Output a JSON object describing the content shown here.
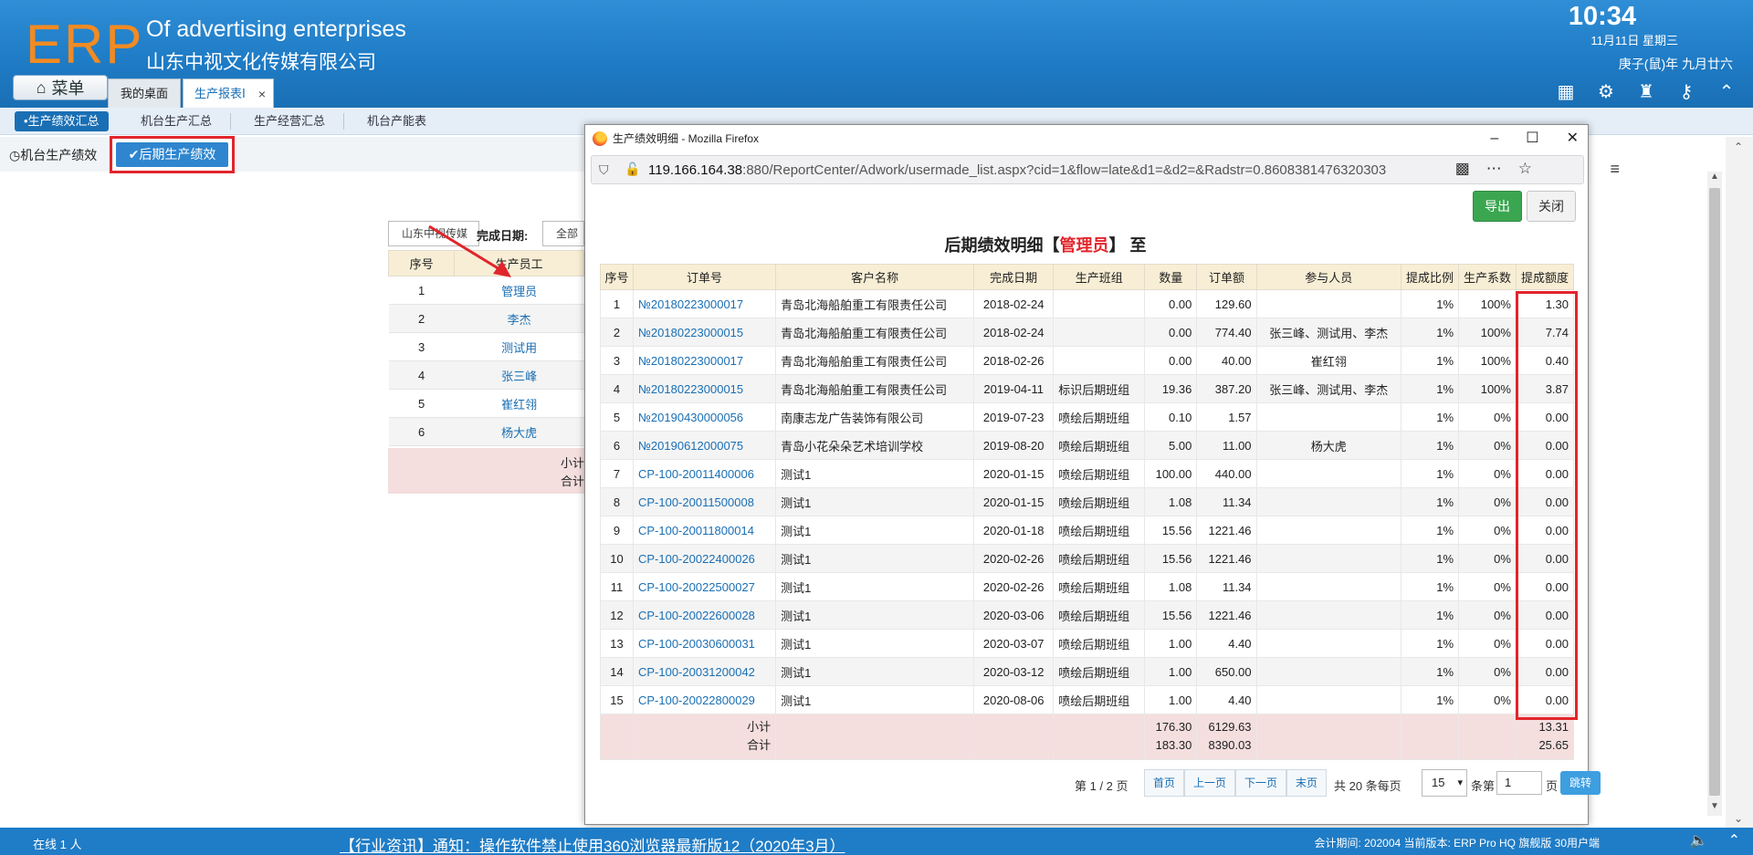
{
  "header": {
    "logo": "ERP",
    "brand_en": "Of advertising enterprises",
    "brand_cn": "山东中视文化传媒有限公司",
    "time": "10:34",
    "date": "11月11日 星期三",
    "lunar": "庚子(鼠)年 九月廿六",
    "menu_label": "菜单",
    "tabs": [
      {
        "label": "我的桌面"
      },
      {
        "label": "生产报表Ⅰ"
      }
    ],
    "tab_close": "×"
  },
  "subnav": {
    "items": [
      "•生产绩效汇总",
      "机台生产汇总",
      "生产经营汇总",
      "机台产能表"
    ]
  },
  "modes": {
    "a": "机台生产绩效",
    "b": "后期生产绩效"
  },
  "bg_list": {
    "company_select": "山东中视传媒",
    "date_label": "完成日期:",
    "date_select": "全部",
    "columns": [
      "序号",
      "生产员工"
    ],
    "rows": [
      {
        "no": "1",
        "name": "管理员"
      },
      {
        "no": "2",
        "name": "李杰"
      },
      {
        "no": "3",
        "name": "测试用"
      },
      {
        "no": "4",
        "name": "张三峰"
      },
      {
        "no": "5",
        "name": "崔红翎"
      },
      {
        "no": "6",
        "name": "杨大虎"
      }
    ],
    "subtotal": "小计",
    "total": "合计"
  },
  "popup": {
    "title": "生产绩效明细 - Mozilla Firefox",
    "url_host": "119.166.164.38",
    "url_rest": ":880/ReportCenter/Adwork/usermade_list.aspx?cid=1&flow=late&d1=&d2=&Radstr=0.8608381476320303",
    "export_label": "导出",
    "close_label": "关闭",
    "report_title_pre": "后期绩效明细【",
    "report_title_user": "管理员",
    "report_title_post": "】 至",
    "columns": [
      "序号",
      "订单号",
      "客户名称",
      "完成日期",
      "生产班组",
      "数量",
      "订单额",
      "参与人员",
      "提成比例",
      "生产系数",
      "提成额度"
    ],
    "rows": [
      [
        "1",
        "№20180223000017",
        "青岛北海船舶重工有限责任公司",
        "2018-02-24",
        "",
        "0.00",
        "129.60",
        "",
        "1%",
        "100%",
        "1.30"
      ],
      [
        "2",
        "№20180223000015",
        "青岛北海船舶重工有限责任公司",
        "2018-02-24",
        "",
        "0.00",
        "774.40",
        "张三峰、测试用、李杰",
        "1%",
        "100%",
        "7.74"
      ],
      [
        "3",
        "№20180223000017",
        "青岛北海船舶重工有限责任公司",
        "2018-02-26",
        "",
        "0.00",
        "40.00",
        "崔红翎",
        "1%",
        "100%",
        "0.40"
      ],
      [
        "4",
        "№20180223000015",
        "青岛北海船舶重工有限责任公司",
        "2019-04-11",
        "标识后期班组",
        "19.36",
        "387.20",
        "张三峰、测试用、李杰",
        "1%",
        "100%",
        "3.87"
      ],
      [
        "5",
        "№20190430000056",
        "南康志龙广告装饰有限公司",
        "2019-07-23",
        "喷绘后期班组",
        "0.10",
        "1.57",
        "",
        "1%",
        "0%",
        "0.00"
      ],
      [
        "6",
        "№20190612000075",
        "青岛小花朵朵艺术培训学校",
        "2019-08-20",
        "喷绘后期班组",
        "5.00",
        "11.00",
        "杨大虎",
        "1%",
        "0%",
        "0.00"
      ],
      [
        "7",
        "CP-100-20011400006",
        "测试1",
        "2020-01-15",
        "喷绘后期班组",
        "100.00",
        "440.00",
        "",
        "1%",
        "0%",
        "0.00"
      ],
      [
        "8",
        "CP-100-20011500008",
        "测试1",
        "2020-01-15",
        "喷绘后期班组",
        "1.08",
        "11.34",
        "",
        "1%",
        "0%",
        "0.00"
      ],
      [
        "9",
        "CP-100-20011800014",
        "测试1",
        "2020-01-18",
        "喷绘后期班组",
        "15.56",
        "1221.46",
        "",
        "1%",
        "0%",
        "0.00"
      ],
      [
        "10",
        "CP-100-20022400026",
        "测试1",
        "2020-02-26",
        "喷绘后期班组",
        "15.56",
        "1221.46",
        "",
        "1%",
        "0%",
        "0.00"
      ],
      [
        "11",
        "CP-100-20022500027",
        "测试1",
        "2020-02-26",
        "喷绘后期班组",
        "1.08",
        "11.34",
        "",
        "1%",
        "0%",
        "0.00"
      ],
      [
        "12",
        "CP-100-20022600028",
        "测试1",
        "2020-03-06",
        "喷绘后期班组",
        "15.56",
        "1221.46",
        "",
        "1%",
        "0%",
        "0.00"
      ],
      [
        "13",
        "CP-100-20030600031",
        "测试1",
        "2020-03-07",
        "喷绘后期班组",
        "1.00",
        "4.40",
        "",
        "1%",
        "0%",
        "0.00"
      ],
      [
        "14",
        "CP-100-20031200042",
        "测试1",
        "2020-03-12",
        "喷绘后期班组",
        "1.00",
        "650.00",
        "",
        "1%",
        "0%",
        "0.00"
      ],
      [
        "15",
        "CP-100-20022800029",
        "测试1",
        "2020-08-06",
        "喷绘后期班组",
        "1.00",
        "4.40",
        "",
        "1%",
        "0%",
        "0.00"
      ]
    ],
    "summary": {
      "subtotal_label": "小计",
      "total_label": "合计",
      "sub_qty": "176.30",
      "total_qty": "183.30",
      "sub_amount": "6129.63",
      "total_amount": "8390.03",
      "sub_commission": "13.31",
      "total_commission": "25.65"
    },
    "pager": {
      "page_info": "第 1 / 2 页",
      "first": "首页",
      "prev": "上一页",
      "next": "下一页",
      "last": "末页",
      "total_info": "共 20 条每页",
      "per_page": "15",
      "per_unit": "条第",
      "page_input": "1",
      "page_unit": "页",
      "go": "跳转"
    }
  },
  "footer": {
    "online": "在线 1 人",
    "news": "【行业资讯】通知：操作软件禁止使用360浏览器最新版12（2020年3月）",
    "info": "会计期间: 202004 当前版本: ERP Pro HQ 旗舰版 30用户端"
  },
  "colors": {
    "header_blue": "#1f7cc6",
    "accent_orange": "#f28b22",
    "highlight_red": "#e1252b",
    "export_green": "#3ba650"
  }
}
